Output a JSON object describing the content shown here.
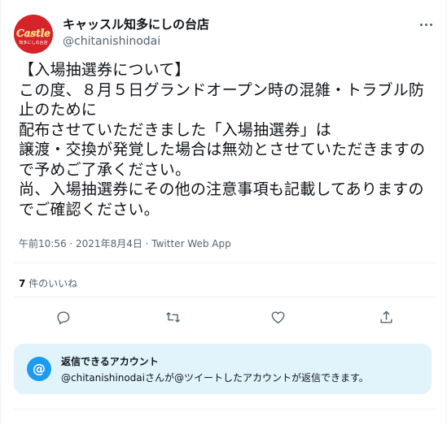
{
  "author": {
    "display_name": "キャッスル知多にしの台店",
    "handle": "@chitanishinodai",
    "avatar_logo_text": "Castle",
    "avatar_sub_text": "知多にしの台店"
  },
  "tweet": {
    "text": "【入場抽選券について】\nこの度、８月５日グランドオープン時の混雑・トラブル防止のために\n配布させていただきました「入場抽選券」は\n譲渡・交換が発覚した場合は無効とさせていただきますので予めご了承ください。\n尚、入場抽選券にその他の注意事項も記載してありますのでご確認ください。",
    "timestamp": "午前10:56 · 2021年8月4日 · Twitter Web App"
  },
  "stats": {
    "likes_count": "7",
    "likes_label": " 件のいいね"
  },
  "actions": {
    "icons": [
      "reply-icon",
      "retweet-icon",
      "like-icon",
      "share-icon"
    ]
  },
  "reply_restriction": {
    "icon": "@",
    "title": "返信できるアカウント",
    "description": "@chitanishinodaiさんが@ツイートしたアカウントが返信できます。"
  },
  "colors": {
    "accent": "#1d9bf0",
    "text_primary": "#0f1419",
    "text_secondary": "#536471",
    "avatar_red": "#d5232a",
    "reply_card_bg": "#e1f4fb"
  }
}
